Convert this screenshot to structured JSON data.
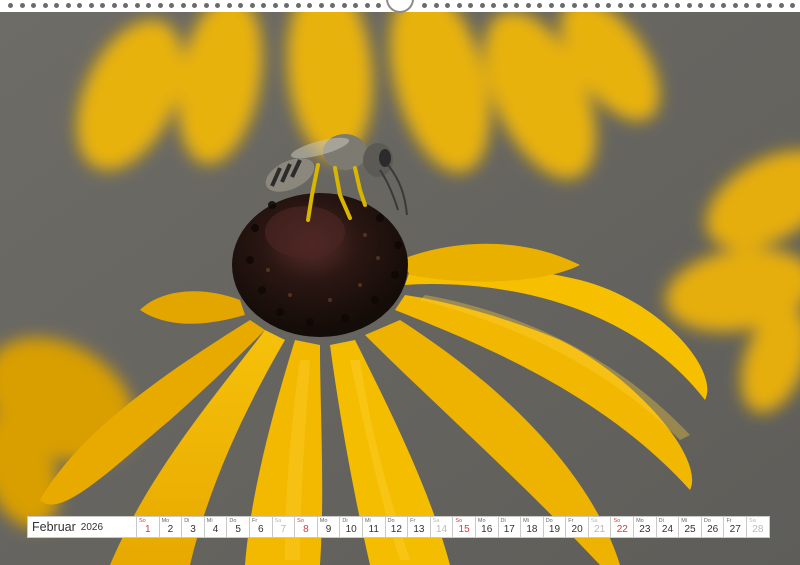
{
  "calendar": {
    "month": "Februar",
    "year": "2026",
    "days": [
      {
        "wd": "So",
        "d": "1",
        "type": "sun"
      },
      {
        "wd": "Mo",
        "d": "2",
        "type": "week"
      },
      {
        "wd": "Di",
        "d": "3",
        "type": "week"
      },
      {
        "wd": "Mi",
        "d": "4",
        "type": "week"
      },
      {
        "wd": "Do",
        "d": "5",
        "type": "week"
      },
      {
        "wd": "Fr",
        "d": "6",
        "type": "week"
      },
      {
        "wd": "Sa",
        "d": "7",
        "type": "sat"
      },
      {
        "wd": "So",
        "d": "8",
        "type": "sun"
      },
      {
        "wd": "Mo",
        "d": "9",
        "type": "week"
      },
      {
        "wd": "Di",
        "d": "10",
        "type": "week"
      },
      {
        "wd": "Mi",
        "d": "11",
        "type": "week"
      },
      {
        "wd": "Do",
        "d": "12",
        "type": "week"
      },
      {
        "wd": "Fr",
        "d": "13",
        "type": "week"
      },
      {
        "wd": "Sa",
        "d": "14",
        "type": "sat"
      },
      {
        "wd": "So",
        "d": "15",
        "type": "sun"
      },
      {
        "wd": "Mo",
        "d": "16",
        "type": "week"
      },
      {
        "wd": "Di",
        "d": "17",
        "type": "week"
      },
      {
        "wd": "Mi",
        "d": "18",
        "type": "week"
      },
      {
        "wd": "Do",
        "d": "19",
        "type": "week"
      },
      {
        "wd": "Fr",
        "d": "20",
        "type": "week"
      },
      {
        "wd": "Sa",
        "d": "21",
        "type": "sat"
      },
      {
        "wd": "So",
        "d": "22",
        "type": "sun"
      },
      {
        "wd": "Mo",
        "d": "23",
        "type": "week"
      },
      {
        "wd": "Di",
        "d": "24",
        "type": "week"
      },
      {
        "wd": "Mi",
        "d": "25",
        "type": "week"
      },
      {
        "wd": "Do",
        "d": "26",
        "type": "week"
      },
      {
        "wd": "Fr",
        "d": "27",
        "type": "week"
      },
      {
        "wd": "Sa",
        "d": "28",
        "type": "sat"
      }
    ]
  },
  "photo": {
    "subject_icon": "bee-on-flower-icon",
    "colors": {
      "background": "#6a6862",
      "petal": "#f2b400",
      "petal_light": "#ffd23a",
      "petal_dark": "#c98a00",
      "cone": "#2a1a14",
      "cone_highlight": "#4a2e26",
      "bee_body": "#8b877c",
      "bee_stripe": "#2b2b2b"
    }
  },
  "colors": {
    "sunday": "#d23c3c",
    "saturday": "#b9b9b9",
    "binding": "#ffffff"
  }
}
